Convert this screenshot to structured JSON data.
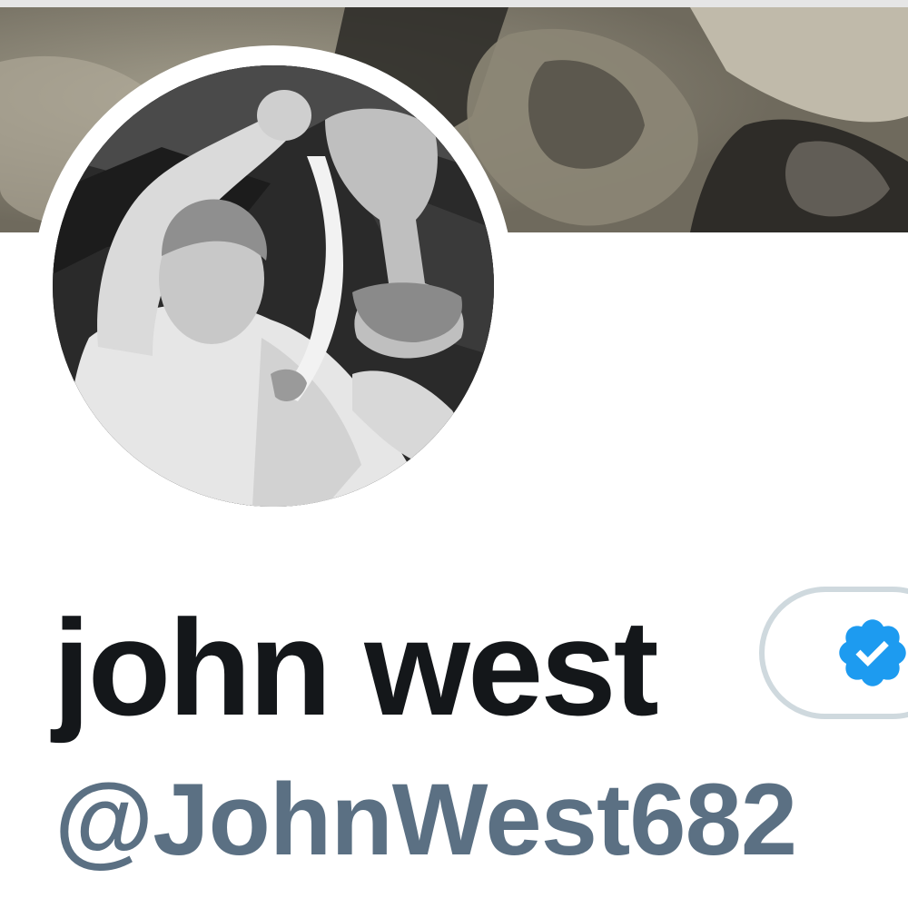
{
  "profile": {
    "display_name": "john west",
    "handle": "@JohnWest682"
  },
  "banner": {
    "icon": "header-photo"
  },
  "avatar": {
    "icon": "profile-photo"
  },
  "badge": {
    "icon": "verified-badge-icon",
    "color": "#1d9bf0"
  },
  "colors": {
    "name": "#14171a",
    "handle": "#5b7083",
    "pill_border": "#cfd9de"
  }
}
